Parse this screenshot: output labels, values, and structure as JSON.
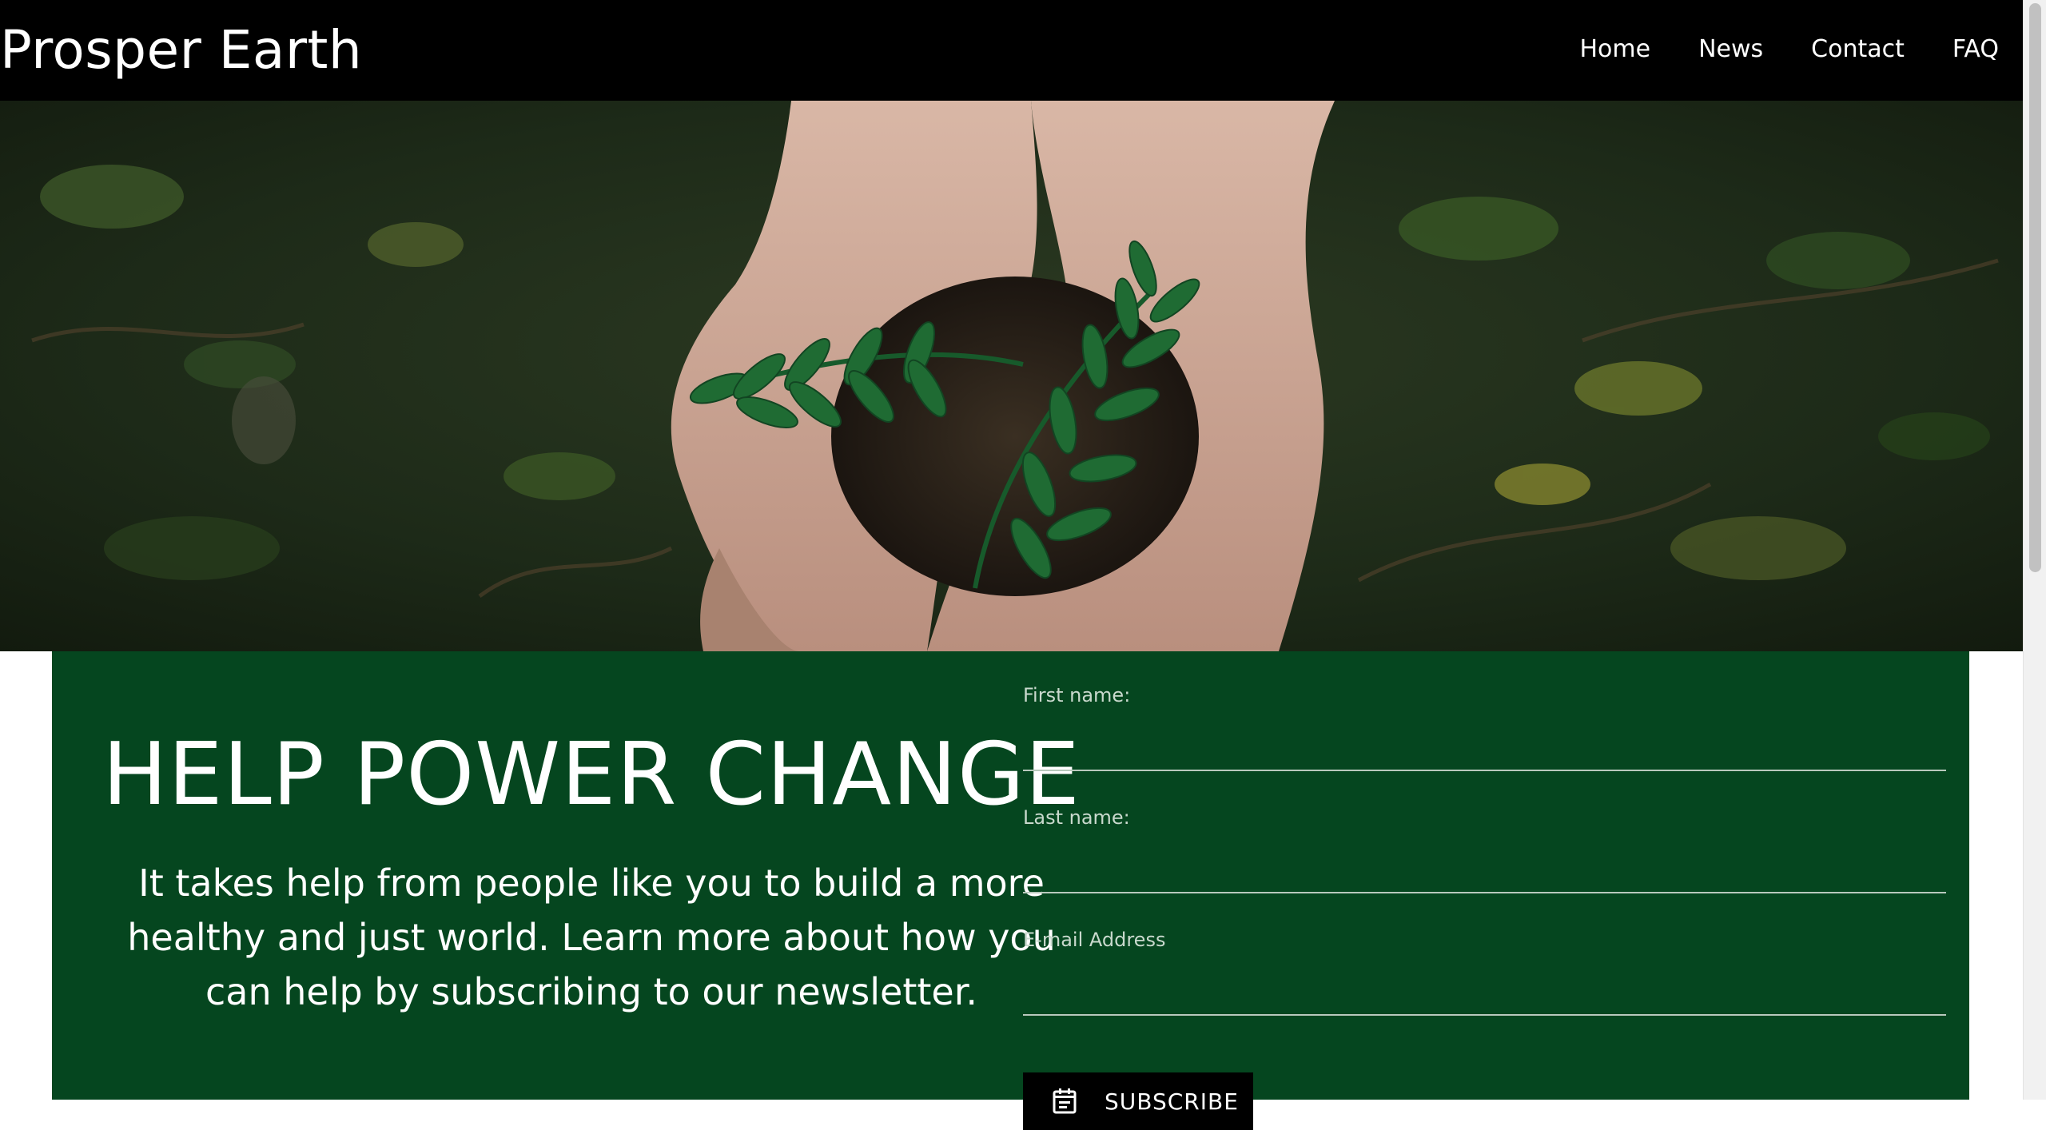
{
  "nav": {
    "brand": "Prosper Earth",
    "links": [
      "Home",
      "News",
      "Contact",
      "FAQ"
    ]
  },
  "hero": {
    "image_icon": "hands-holding-seedling-image"
  },
  "signup": {
    "headline": "HELP POWER CHANGE",
    "description": "It takes help from people like you to build a more healthy and just world. Learn more about how you can help by subscribing to our newsletter.",
    "fields": {
      "first_name_label": "First name:",
      "last_name_label": "Last name:",
      "email_label": "E-mail Address"
    },
    "subscribe_label": "SUBSCRIBE",
    "subscribe_icon": "calendar-note-icon"
  },
  "colors": {
    "nav_bg": "#000000",
    "panel_green": "#05461f",
    "button_bg": "#000000",
    "text_light": "#ffffff"
  }
}
